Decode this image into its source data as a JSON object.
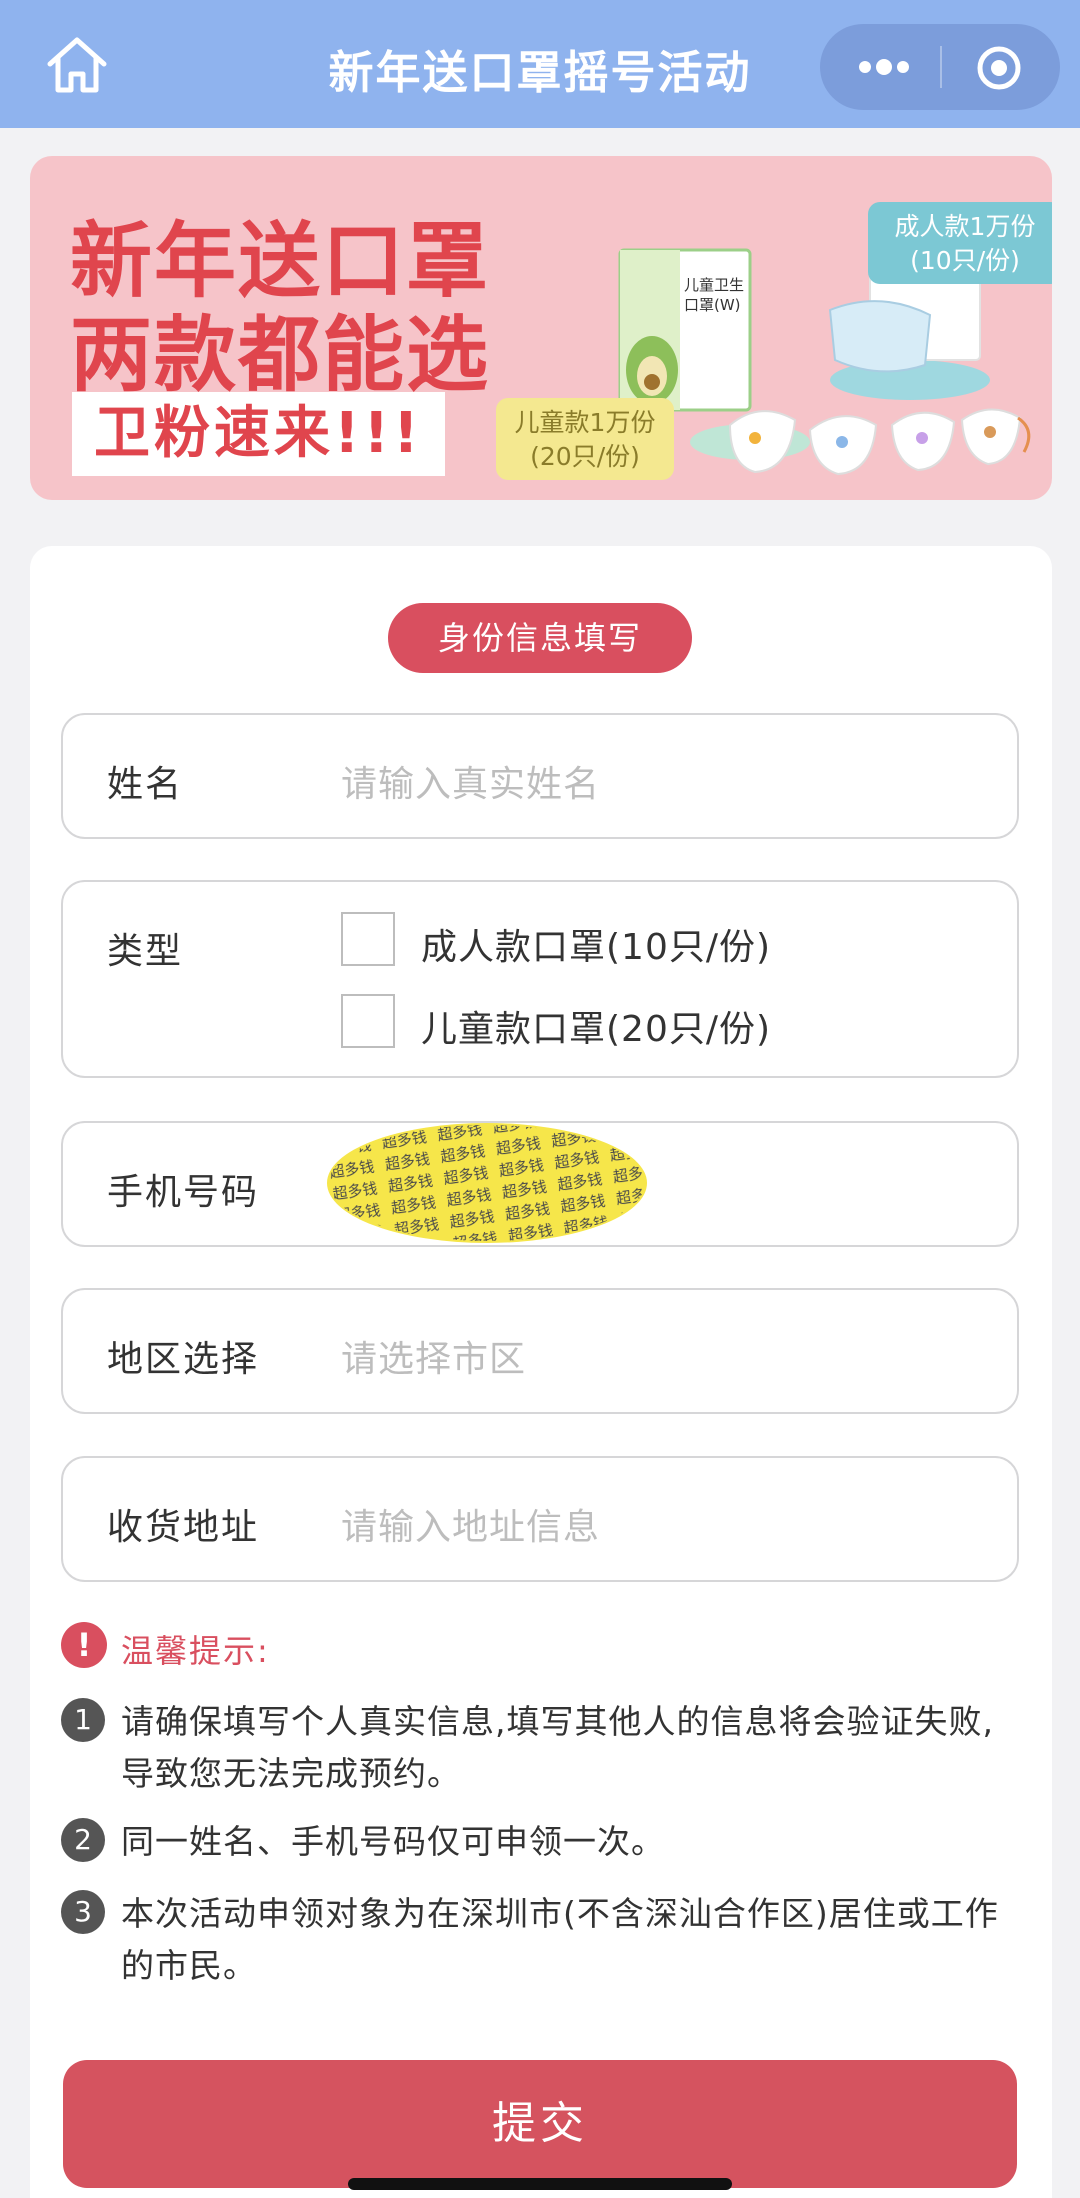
{
  "navbar": {
    "title": "新年送口罩摇号活动",
    "home_icon": "home-icon",
    "more_icon": "more-dots-icon",
    "close_icon": "target-close-icon",
    "color": "#8fb3ee"
  },
  "banner": {
    "line1": "新年送口罩",
    "line2": "两款都能选",
    "chip": "卫粉速来!!!",
    "adult_tag_1": "成人款1万份",
    "adult_tag_2": "(10只/份)",
    "kid_tag_1": "儿童款1万份",
    "kid_tag_2": "(20只/份)",
    "bg_color": "#f6c4c9"
  },
  "form": {
    "section_title": "身份信息填写",
    "name": {
      "label": "姓名",
      "placeholder": "请输入真实姓名"
    },
    "type": {
      "label": "类型",
      "options": [
        {
          "label": "成人款口罩(10只/份)",
          "checked": false
        },
        {
          "label": "儿童款口罩(20只/份)",
          "checked": false
        }
      ]
    },
    "phone": {
      "label": "手机号码",
      "redaction_text": "超多钱"
    },
    "region": {
      "label": "地区选择",
      "placeholder": "请选择市区"
    },
    "address": {
      "label": "收货地址",
      "placeholder": "请输入地址信息"
    }
  },
  "tips": {
    "title": "温馨提示:",
    "items": [
      {
        "num": "1",
        "text": "请确保填写个人真实信息,填写其他人的信息将会验证失败,导致您无法完成预约。"
      },
      {
        "num": "2",
        "text": "同一姓名、手机号码仅可申领一次。"
      },
      {
        "num": "3",
        "text": "本次活动申领对象为在深圳市(不含深汕合作区)居住或工作的市民。"
      }
    ]
  },
  "submit_label": "提交",
  "accent_color": "#d94f5f"
}
